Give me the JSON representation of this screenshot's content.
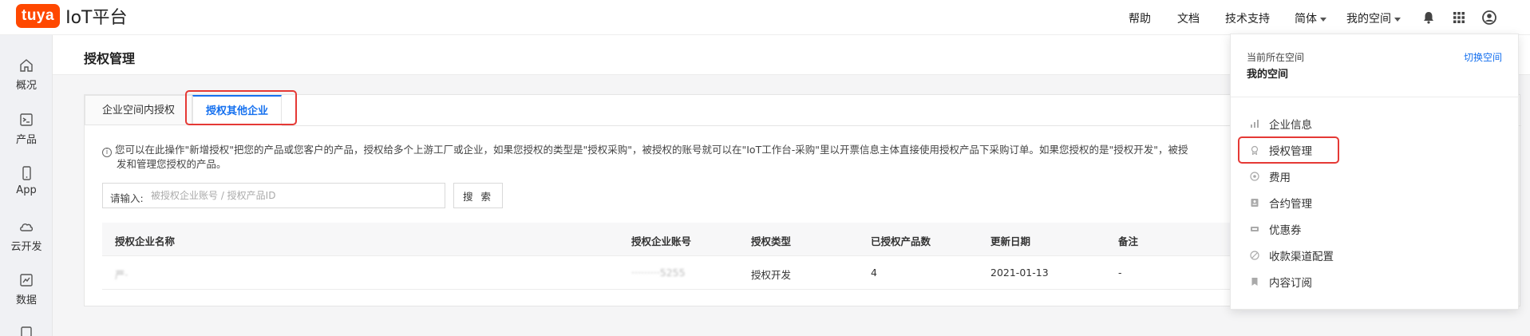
{
  "brand": {
    "badge": "tuya",
    "name": "IoT平台",
    "badge_color": "#ff4800"
  },
  "topnav": {
    "help": "帮助",
    "docs": "文档",
    "support": "技术支持",
    "language": "简体",
    "space": "我的空间",
    "icons": [
      "bell-icon",
      "apps-grid-icon",
      "user-avatar-icon"
    ]
  },
  "sidebar": {
    "items": [
      {
        "label": "概况",
        "icon": "home-icon"
      },
      {
        "label": "产品",
        "icon": "terminal-icon"
      },
      {
        "label": "App",
        "icon": "phone-icon"
      },
      {
        "label": "云开发",
        "icon": "cloud-icon"
      },
      {
        "label": "数据",
        "icon": "chart-icon"
      }
    ]
  },
  "page": {
    "title": "授权管理"
  },
  "tabs": [
    {
      "label": "企业空间内授权",
      "active": false
    },
    {
      "label": "授权其他企业",
      "active": true
    }
  ],
  "notice": {
    "line1": "您可以在此操作\"新增授权\"把您的产品或您客户的产品，授权给多个上游工厂或企业，如果您授权的类型是\"授权采购\"，被授权的账号就可以在\"IoT工作台-采购\"里以开票信息主体直接使用授权产品下采购订单。如果您授权的是\"授权开发\"，被授",
    "line2": "发和管理您授权的产品。"
  },
  "search": {
    "label": "请输入:",
    "placeholder": "被授权企业账号 / 授权产品ID",
    "value": "",
    "button": "搜 索"
  },
  "table": {
    "columns": [
      "授权企业名称",
      "授权企业账号",
      "授权类型",
      "已授权产品数",
      "更新日期",
      "备注"
    ],
    "rows": [
      {
        "name": "严·",
        "account": "·········5255",
        "type": "授权开发",
        "count": "4",
        "date": "2021-01-13",
        "note": "-"
      }
    ]
  },
  "dropdown": {
    "caption": "当前所在空间",
    "current": "我的空间",
    "switch": "切换空间",
    "items": [
      {
        "label": "企业信息",
        "icon": "bar-chart-icon"
      },
      {
        "label": "授权管理",
        "icon": "badge-icon"
      },
      {
        "label": "费用",
        "icon": "coin-icon"
      },
      {
        "label": "合约管理",
        "icon": "contract-icon"
      },
      {
        "label": "优惠券",
        "icon": "coupon-icon"
      },
      {
        "label": "收款渠道配置",
        "icon": "channel-icon"
      },
      {
        "label": "内容订阅",
        "icon": "bookmark-icon"
      }
    ]
  },
  "colors": {
    "accent": "#1570ef",
    "highlight": "#e53935"
  }
}
